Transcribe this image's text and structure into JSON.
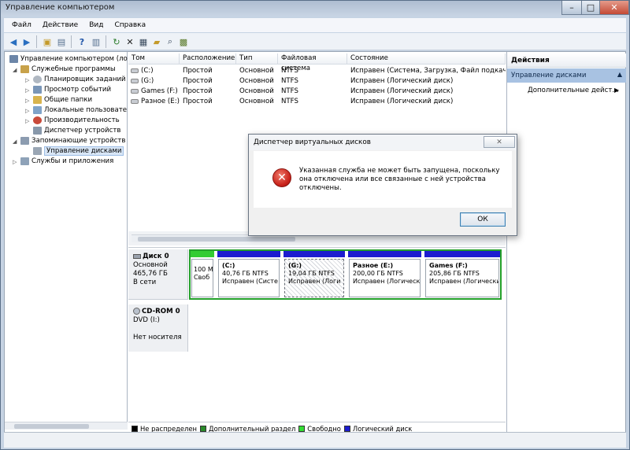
{
  "window": {
    "title": "Управление компьютером",
    "min_glyph": "–",
    "max_glyph": "□",
    "close_glyph": "✕"
  },
  "menu": [
    "Файл",
    "Действие",
    "Вид",
    "Справка"
  ],
  "toolbar_icons": [
    "back-icon",
    "forward-icon",
    "up-folder-icon",
    "show-tree-icon",
    "help-icon",
    "view-icon",
    "refresh-icon",
    "delete-icon",
    "properties-icon",
    "open-icon",
    "search-icon",
    "export-icon"
  ],
  "tree": {
    "root": "Управление компьютером (ло",
    "utilities": "Служебные программы",
    "scheduler": "Планировщик заданий",
    "events": "Просмотр событий",
    "shared": "Общие папки",
    "users": "Локальные пользовате",
    "performance": "Производительность",
    "devices": "Диспетчер устройств",
    "storage": "Запоминающие устройств",
    "disk_mgmt": "Управление дисками",
    "services": "Службы и приложения"
  },
  "columns": [
    "Том",
    "Расположение",
    "Тип",
    "Файловая система",
    "Состояние"
  ],
  "volumes": [
    {
      "name": "(C:)",
      "layout": "Простой",
      "type": "Основной",
      "fs": "NTFS",
      "status": "Исправен (Система, Загрузка, Файл подкачки, А"
    },
    {
      "name": "(G:)",
      "layout": "Простой",
      "type": "Основной",
      "fs": "NTFS",
      "status": "Исправен (Логический диск)"
    },
    {
      "name": "Games (F:)",
      "layout": "Простой",
      "type": "Основной",
      "fs": "NTFS",
      "status": "Исправен (Логический диск)"
    },
    {
      "name": "Разное (E:)",
      "layout": "Простой",
      "type": "Основной",
      "fs": "NTFS",
      "status": "Исправен (Логический диск)"
    }
  ],
  "disk0": {
    "title": "Диск 0",
    "kind": "Основной",
    "size": "465,76 ГБ",
    "state": "В сети"
  },
  "partitions": [
    {
      "name": "",
      "size": "100 М",
      "status": "Своб",
      "color": "#33cc33"
    },
    {
      "name": "(C:)",
      "size": "40,76 ГБ NTFS",
      "status": "Исправен (Систе",
      "color": "#1c1ccf"
    },
    {
      "name": "(G:)",
      "size": "19,04 ГБ NTFS",
      "status": "Исправен (Логи",
      "color": "#1c1ccf"
    },
    {
      "name": "Разное (E:)",
      "size": "200,00 ГБ NTFS",
      "status": "Исправен (Логически",
      "color": "#1c1ccf"
    },
    {
      "name": "Games (F:)",
      "size": "205,86 ГБ NTFS",
      "status": "Исправен (Логически",
      "color": "#1c1ccf"
    }
  ],
  "cdrom": {
    "title": "CD-ROM 0",
    "drive": "DVD (I:)",
    "media": "Нет носителя"
  },
  "legend": [
    {
      "label": "Не распределен",
      "color": "#000000"
    },
    {
      "label": "Дополнительный раздел",
      "color": "#2a8a2a"
    },
    {
      "label": "Свободно",
      "color": "#33dd33"
    },
    {
      "label": "Логический диск",
      "color": "#1c1ccf"
    }
  ],
  "actions": {
    "header": "Действия",
    "section": "Управление дисками",
    "more": "Дополнительные дейст...",
    "arrow_up": "▲",
    "arrow_right": "▶"
  },
  "dialog": {
    "title": "Диспетчер виртуальных дисков",
    "close_glyph": "✕",
    "message": "Указанная служба не может быть запущена, поскольку она отключена или все связанные с ней устройства отключены.",
    "ok": "ОК",
    "icon_glyph": "✕"
  },
  "colors": {
    "selection": "#d8e6f6",
    "actions_header": "#a8c2e2",
    "disk_border": "#23a02a"
  }
}
